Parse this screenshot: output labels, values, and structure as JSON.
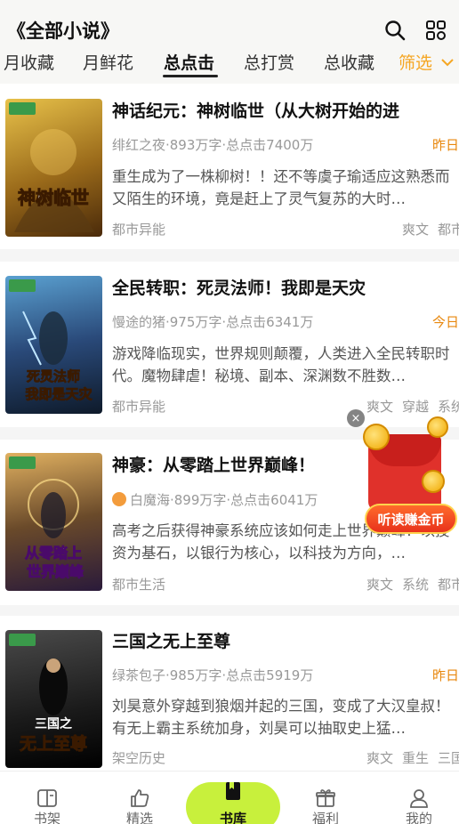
{
  "header": {
    "title": "《全部小说》",
    "search_icon": "search-icon",
    "scan_icon": "grid-icon"
  },
  "tabs": [
    {
      "label": "月收藏"
    },
    {
      "label": "月鲜花"
    },
    {
      "label": "总点击"
    },
    {
      "label": "总打赏"
    },
    {
      "label": "总收藏"
    },
    {
      "label": "筛选"
    }
  ],
  "books": [
    {
      "title": "神话纪元：神树临世（从大树开始的进",
      "meta": "绯红之夜·893万字·总点击7400万",
      "date": "昨日",
      "desc": "重生成为了一株柳树！！还不等虞子瑜适应这熟悉而又陌生的环境，竟是赶上了灵气复苏的大时…",
      "genre": "都市异能",
      "tags": [
        "爽文",
        "都市"
      ],
      "cover_text": "神树临世",
      "cover_colors": [
        "#e8c24a",
        "#6a3b12"
      ]
    },
    {
      "title": "全民转职：死灵法师！我即是天灾",
      "meta": "慢途的猪·975万字·总点击6341万",
      "date": "今日",
      "desc": "游戏降临现实，世界规则颠覆，人类进入全民转职时代。魔物肆虐！秘境、副本、深渊数不胜数…",
      "genre": "都市异能",
      "tags": [
        "爽文",
        "穿越",
        "系统"
      ],
      "cover_text": "死灵法师 我即是天灾",
      "cover_colors": [
        "#2a6a9a",
        "#0e1a2a"
      ]
    },
    {
      "title": "神豪：从零踏上世界巅峰！",
      "meta": "白魔海·899万字·总点击6041万",
      "date": "",
      "desc": "高考之后获得神豪系统应该如何走上世界巅峰？以投资为基石，以银行为核心，以科技为方向，…",
      "genre": "都市生活",
      "tags": [
        "爽文",
        "系统",
        "都市"
      ],
      "cover_text": "从零踏上 世界巅峰",
      "cover_colors": [
        "#c78a3a",
        "#2a1a3a"
      ]
    },
    {
      "title": "三国之无上至尊",
      "meta": "绿茶包子·985万字·总点击5919万",
      "date": "昨日",
      "desc": "刘昊意外穿越到狼烟并起的三国，变成了大汉皇叔！有无上霸主系统加身，刘昊可以抽取史上猛…",
      "genre": "架空历史",
      "tags": [
        "爽文",
        "重生",
        "三国"
      ],
      "cover_text": "三国之 无上至尊",
      "cover_colors": [
        "#3a3a3a",
        "#0a0a0a"
      ]
    }
  ],
  "float_ad": {
    "close": "×",
    "button_label": "听读赚金币"
  },
  "bottom_nav": [
    {
      "label": "书架",
      "icon": "bookshelf-icon"
    },
    {
      "label": "精选",
      "icon": "thumbs-up-icon"
    },
    {
      "label": "书库",
      "icon": "library-icon"
    },
    {
      "label": "福利",
      "icon": "gift-icon"
    },
    {
      "label": "我的",
      "icon": "profile-icon"
    }
  ]
}
